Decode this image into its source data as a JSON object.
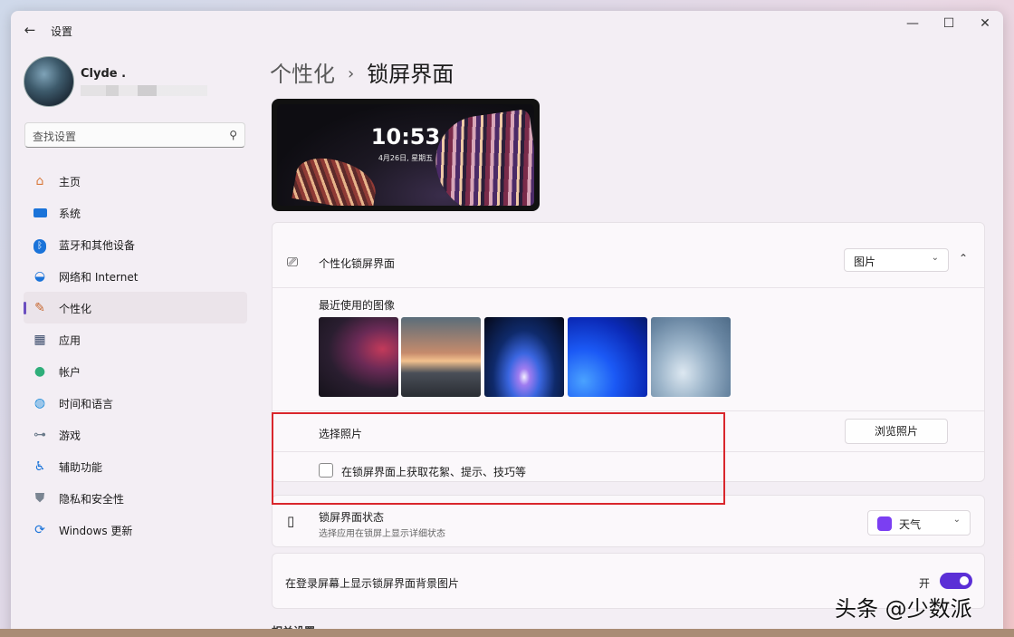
{
  "window": {
    "title": "设置"
  },
  "user": {
    "name": "Clyde ."
  },
  "search": {
    "placeholder": "查找设置"
  },
  "sidebar": {
    "items": [
      {
        "label": "主页",
        "icon": "home-icon"
      },
      {
        "label": "系统",
        "icon": "monitor-icon"
      },
      {
        "label": "蓝牙和其他设备",
        "icon": "bluetooth-icon"
      },
      {
        "label": "网络和 Internet",
        "icon": "wifi-icon"
      },
      {
        "label": "个性化",
        "icon": "brush-icon"
      },
      {
        "label": "应用",
        "icon": "apps-icon"
      },
      {
        "label": "帐户",
        "icon": "person-icon"
      },
      {
        "label": "时间和语言",
        "icon": "globe-clock-icon"
      },
      {
        "label": "游戏",
        "icon": "gamepad-icon"
      },
      {
        "label": "辅助功能",
        "icon": "accessibility-icon"
      },
      {
        "label": "隐私和安全性",
        "icon": "shield-icon"
      },
      {
        "label": "Windows 更新",
        "icon": "update-icon"
      }
    ],
    "active_index": 4
  },
  "breadcrumb": {
    "parent": "个性化",
    "separator": "›",
    "current": "锁屏界面"
  },
  "preview": {
    "time": "10:53",
    "date": "4月26日, 星期五"
  },
  "lockscreen": {
    "title": "个性化锁屏界面",
    "dropdown_value": "图片",
    "recent_label": "最近使用的图像",
    "choose_label": "选择照片",
    "browse_label": "浏览照片",
    "tips_label": "在锁屏界面上获取花絮、提示、技巧等",
    "tips_checked": false
  },
  "status": {
    "title": "锁屏界面状态",
    "subtitle": "选择应用在锁屏上显示详细状态",
    "value": "天气"
  },
  "signin_bg": {
    "title": "在登录屏幕上显示锁屏界面背景图片",
    "state": "开",
    "on": true
  },
  "related": "相关设置",
  "watermark": "头条 @少数派",
  "colors": {
    "accent": "#5b2fd6",
    "highlight": "#d9262c"
  }
}
